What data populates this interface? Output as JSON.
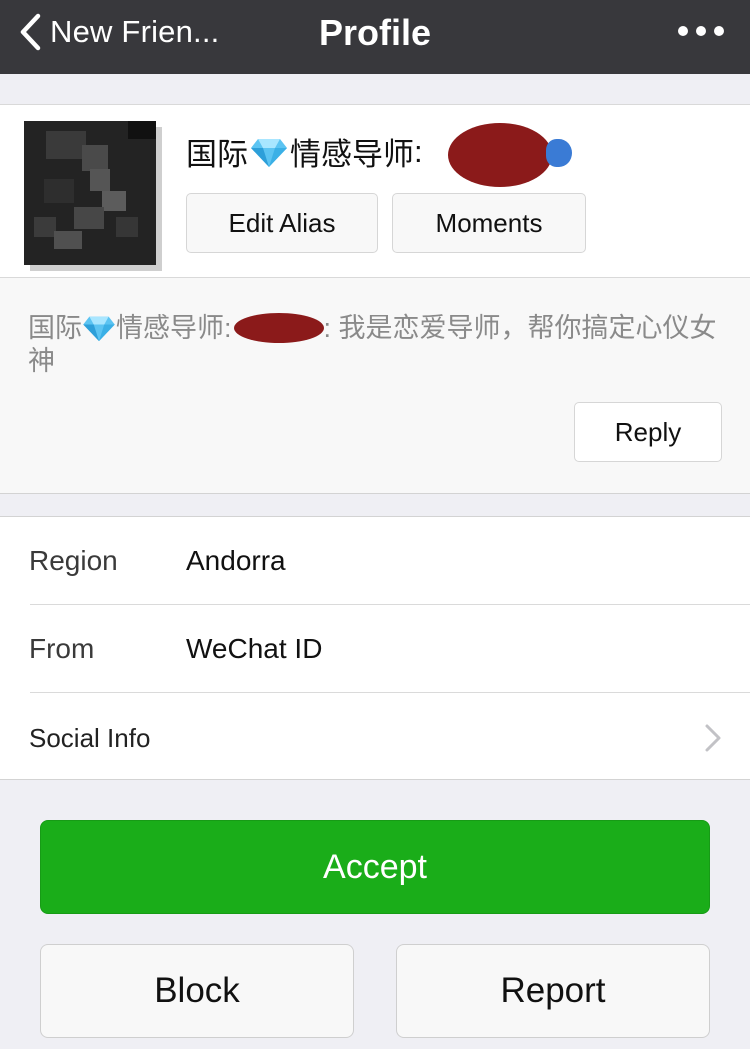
{
  "nav": {
    "back_label": "New Frien...",
    "title": "Profile",
    "more_icon": "more-dots-icon"
  },
  "profile": {
    "name_prefix": "国际",
    "name_middle": "情感导师",
    "name_suffix": ":",
    "edit_alias_label": "Edit Alias",
    "moments_label": "Moments"
  },
  "message": {
    "prefix": "国际",
    "middle": "情感导师",
    "colon": ":",
    "text": ": 我是恋爱导师，帮你搞定心仪女神",
    "reply_label": "Reply"
  },
  "info": {
    "rows": [
      {
        "label": "Region",
        "value": "Andorra"
      },
      {
        "label": "From",
        "value": "WeChat ID"
      },
      {
        "label": "Social Info",
        "value": ""
      }
    ]
  },
  "actions": {
    "accept_label": "Accept",
    "block_label": "Block",
    "report_label": "Report"
  },
  "colors": {
    "nav_bg": "#38383c",
    "accept_green": "#1aad19",
    "redaction_red": "#8b1a1a",
    "page_bg": "#efeff4"
  }
}
